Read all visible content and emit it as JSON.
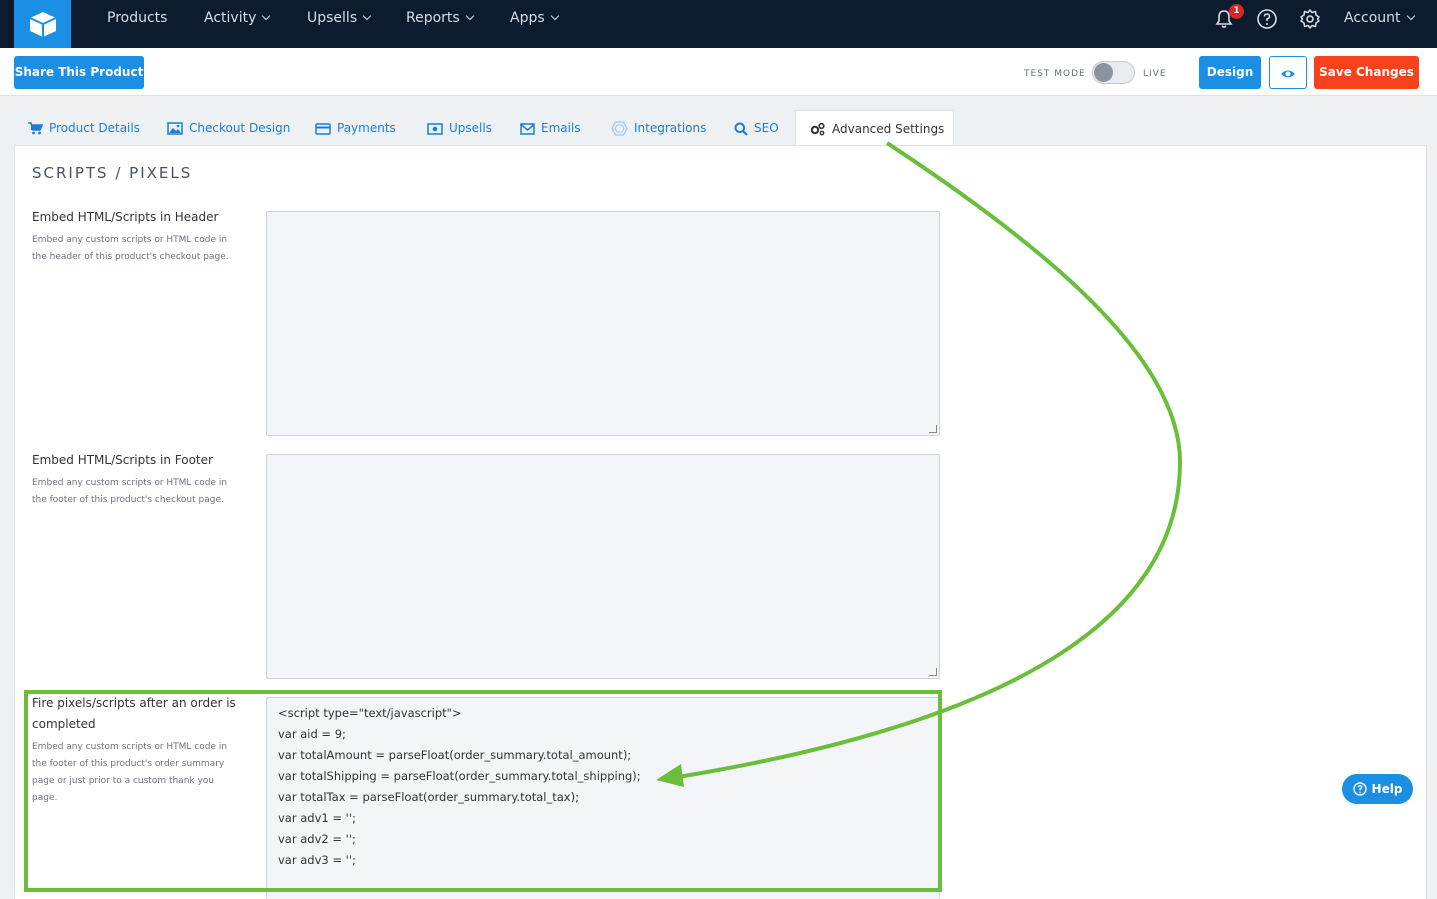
{
  "nav": {
    "items": [
      {
        "label": "Products",
        "dropdown": false
      },
      {
        "label": "Activity",
        "dropdown": true
      },
      {
        "label": "Upsells",
        "dropdown": true
      },
      {
        "label": "Reports",
        "dropdown": true
      },
      {
        "label": "Apps",
        "dropdown": true
      }
    ],
    "notification_count": "1",
    "account_label": "Account"
  },
  "toolbar": {
    "share_label": "Share This Product",
    "test_mode_label": "TEST MODE",
    "live_label": "LIVE",
    "design_label": "Design",
    "save_label": "Save Changes"
  },
  "tabs": [
    {
      "label": "Product Details",
      "icon": "cart-icon"
    },
    {
      "label": "Checkout Design",
      "icon": "image-icon"
    },
    {
      "label": "Payments",
      "icon": "credit-card-icon"
    },
    {
      "label": "Upsells",
      "icon": "money-icon"
    },
    {
      "label": "Emails",
      "icon": "envelope-icon"
    },
    {
      "label": "Integrations",
      "icon": "hexagon-icon"
    },
    {
      "label": "SEO",
      "icon": "search-icon"
    },
    {
      "label": "Advanced Settings",
      "icon": "gears-icon",
      "active": true
    }
  ],
  "section": {
    "title": "SCRIPTS / PIXELS",
    "fields": [
      {
        "label": "Embed HTML/Scripts in Header",
        "help_lines": [
          "Embed any custom scripts or HTML code in",
          "the header of this product's checkout page."
        ],
        "value": ""
      },
      {
        "label": "Embed HTML/Scripts in Footer",
        "help_lines": [
          "Embed any custom scripts or HTML code in",
          "the footer of this product's checkout page."
        ],
        "value": ""
      },
      {
        "label_lines": [
          "Fire pixels/scripts after an order is",
          "completed"
        ],
        "help_lines": [
          "Embed any custom scripts or HTML code in",
          "the footer of this product's order summary",
          "page or just prior to a custom thank you",
          "page."
        ],
        "code_lines": [
          "<script type=\"text/javascript\">",
          "var aid = 9;",
          "var totalAmount = parseFloat(order_summary.total_amount);",
          "var totalShipping = parseFloat(order_summary.total_shipping);",
          "var totalTax = parseFloat(order_summary.total_tax);",
          "var adv1 = '';",
          "var adv2 = '';",
          "var adv3 = '';"
        ]
      }
    ]
  },
  "help_button": {
    "label": "Help"
  },
  "colors": {
    "nav_bg": "#0c1b2e",
    "primary": "#1a8fe3",
    "save": "#f7421c",
    "annotation": "#6abf3a"
  }
}
